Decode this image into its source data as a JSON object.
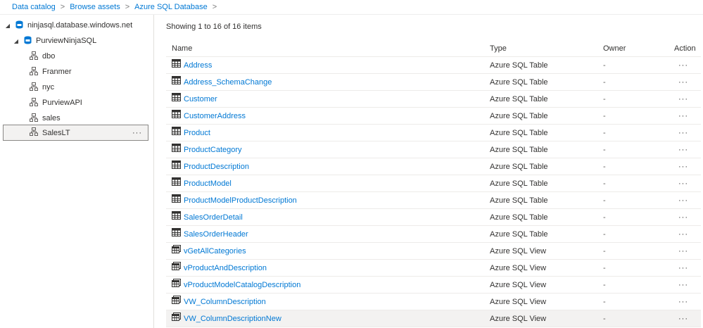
{
  "breadcrumb": {
    "items": [
      "Data catalog",
      "Browse assets",
      "Azure SQL Database"
    ],
    "separator": ">"
  },
  "tree": {
    "server": "ninjasql.database.windows.net",
    "database": "PurviewNinjaSQL",
    "schemas": [
      "dbo",
      "Franmer",
      "nyc",
      "PurviewAPI",
      "sales",
      "SalesLT"
    ],
    "selected": "SalesLT",
    "more_label": "···"
  },
  "main": {
    "showing": "Showing 1 to 16 of 16 items",
    "columns": {
      "name": "Name",
      "type": "Type",
      "owner": "Owner",
      "action": "Action"
    },
    "rows": [
      {
        "name": "Address",
        "type": "Azure SQL Table",
        "owner": "-",
        "icon": "table-icon"
      },
      {
        "name": "Address_SchemaChange",
        "type": "Azure SQL Table",
        "owner": "-",
        "icon": "table-icon"
      },
      {
        "name": "Customer",
        "type": "Azure SQL Table",
        "owner": "-",
        "icon": "table-icon"
      },
      {
        "name": "CustomerAddress",
        "type": "Azure SQL Table",
        "owner": "-",
        "icon": "table-icon"
      },
      {
        "name": "Product",
        "type": "Azure SQL Table",
        "owner": "-",
        "icon": "table-icon"
      },
      {
        "name": "ProductCategory",
        "type": "Azure SQL Table",
        "owner": "-",
        "icon": "table-icon"
      },
      {
        "name": "ProductDescription",
        "type": "Azure SQL Table",
        "owner": "-",
        "icon": "table-icon"
      },
      {
        "name": "ProductModel",
        "type": "Azure SQL Table",
        "owner": "-",
        "icon": "table-icon"
      },
      {
        "name": "ProductModelProductDescription",
        "type": "Azure SQL Table",
        "owner": "-",
        "icon": "table-icon"
      },
      {
        "name": "SalesOrderDetail",
        "type": "Azure SQL Table",
        "owner": "-",
        "icon": "table-icon"
      },
      {
        "name": "SalesOrderHeader",
        "type": "Azure SQL Table",
        "owner": "-",
        "icon": "table-icon"
      },
      {
        "name": "vGetAllCategories",
        "type": "Azure SQL View",
        "owner": "-",
        "icon": "view-icon"
      },
      {
        "name": "vProductAndDescription",
        "type": "Azure SQL View",
        "owner": "-",
        "icon": "view-icon"
      },
      {
        "name": "vProductModelCatalogDescription",
        "type": "Azure SQL View",
        "owner": "-",
        "icon": "view-icon"
      },
      {
        "name": "VW_ColumnDescription",
        "type": "Azure SQL View",
        "owner": "-",
        "icon": "view-icon"
      },
      {
        "name": "VW_ColumnDescriptionNew",
        "type": "Azure SQL View",
        "owner": "-",
        "icon": "view-icon"
      }
    ],
    "action_label": "···"
  },
  "colors": {
    "link": "#0078d4",
    "db_icon": "#0078d4",
    "selected_bg": "#f3f2f1"
  }
}
